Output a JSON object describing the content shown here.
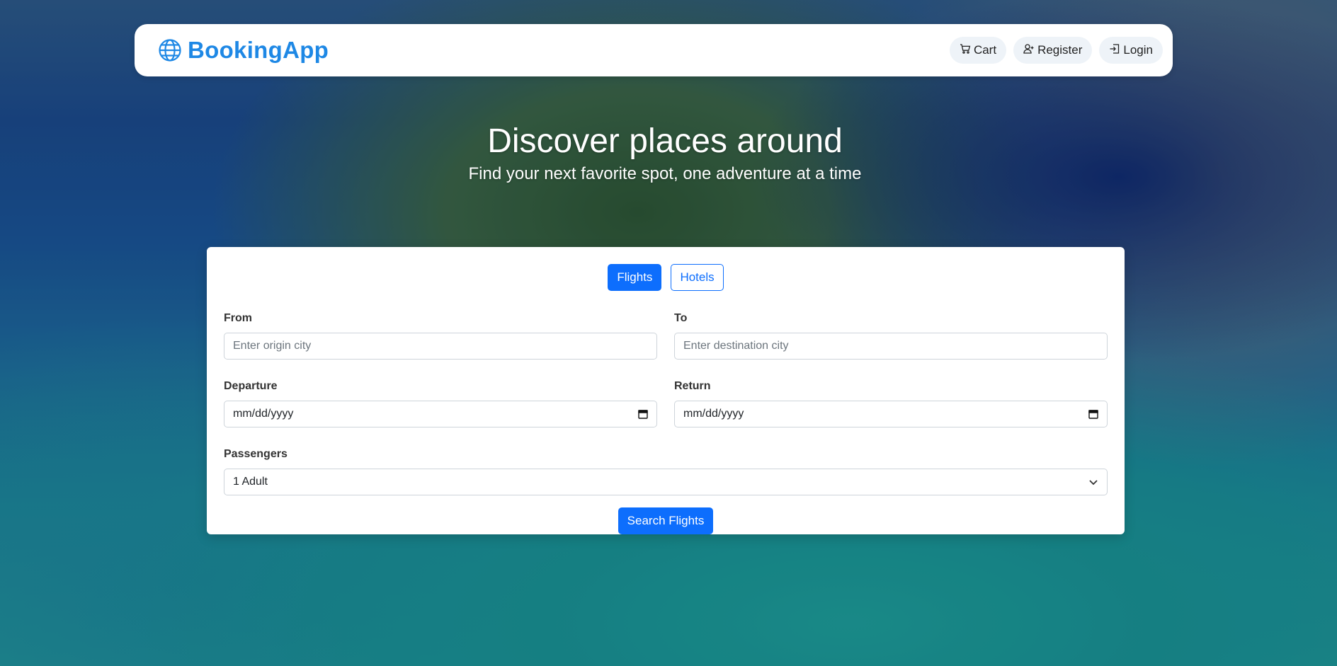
{
  "brand": {
    "name": "BookingApp",
    "icon": "globe-icon"
  },
  "nav": {
    "cart_label": "Cart",
    "register_label": "Register",
    "login_label": "Login"
  },
  "hero": {
    "title": "Discover places around",
    "subtitle": "Find your next favorite spot, one adventure at a time"
  },
  "search": {
    "tabs": [
      {
        "label": "Flights",
        "active": true
      },
      {
        "label": "Hotels",
        "active": false
      }
    ],
    "from": {
      "label": "From",
      "placeholder": "Enter origin city"
    },
    "to": {
      "label": "To",
      "placeholder": "Enter destination city"
    },
    "departure": {
      "label": "Departure",
      "value": "mm/dd/yyyy"
    },
    "return": {
      "label": "Return",
      "value": "mm/dd/yyyy"
    },
    "passengers": {
      "label": "Passengers",
      "value": "1 Adult"
    },
    "submit_label": "Search Flights"
  },
  "colors": {
    "brand": "#1e88e5",
    "primary": "#0d6efd"
  }
}
